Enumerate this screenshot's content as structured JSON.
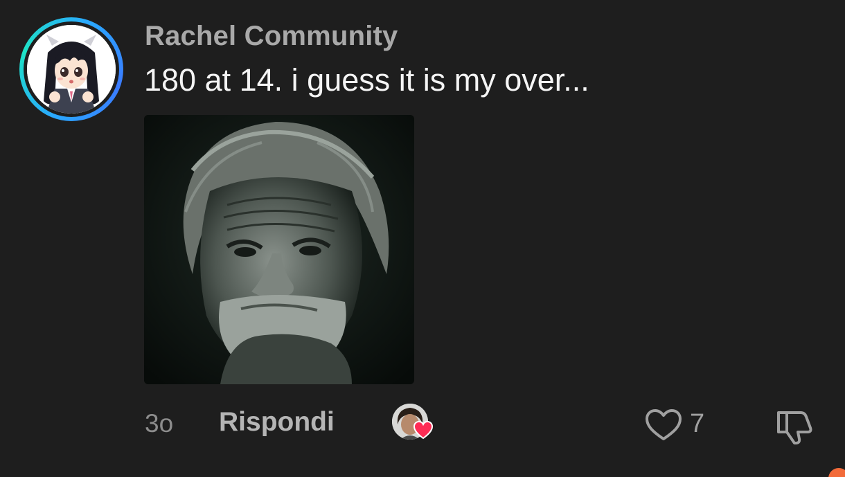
{
  "comment": {
    "author": "Rachel Community",
    "text": "180 at 14. i guess it is my over...",
    "timestamp": "3o",
    "reply_label": "Rispondi",
    "like_count": "7"
  },
  "colors": {
    "background": "#1e1e1e",
    "author": "#a9a9a9",
    "text": "#f5f5f5",
    "meta": "#8d8d8d",
    "avatar_ring": "#2aa8ff",
    "creator_heart": "#fe2c55"
  },
  "icons": {
    "like": "heart-outline-icon",
    "dislike": "thumbs-down-icon",
    "creator_like": "heart-filled-icon"
  }
}
